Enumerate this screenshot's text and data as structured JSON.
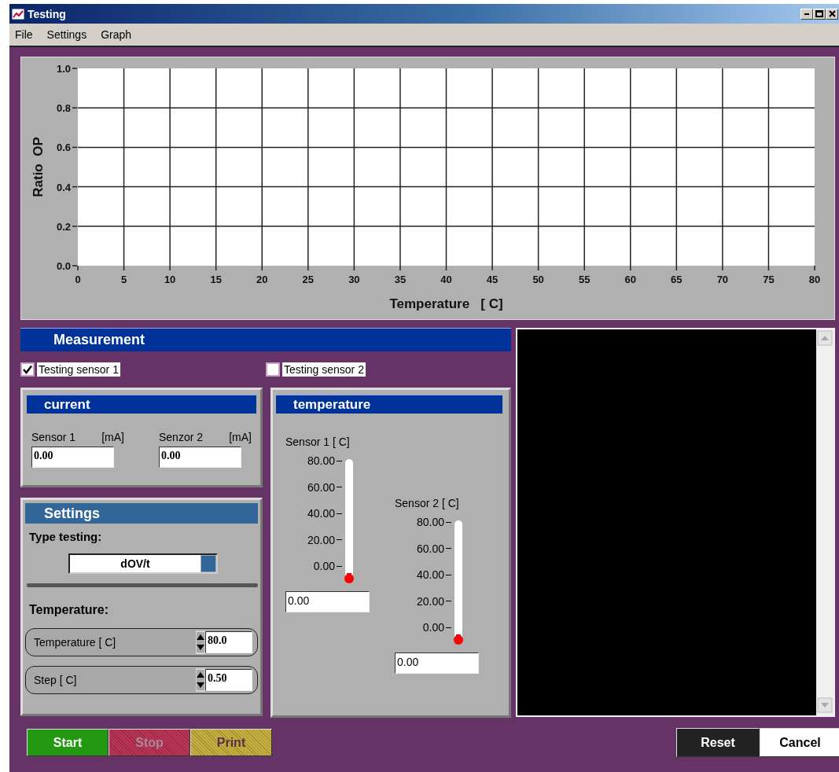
{
  "window": {
    "title": "Testing"
  },
  "menu": [
    {
      "label": "File"
    },
    {
      "label": "Settings"
    },
    {
      "label": "Graph"
    }
  ],
  "graph": {
    "chart_data": {
      "type": "line",
      "grid": true,
      "xlabel": "Temperature   [ C]",
      "ylabel": "Ratio  OP",
      "xlim": [
        0,
        80
      ],
      "ylim": [
        0,
        1
      ],
      "xticks": [
        0,
        5,
        10,
        15,
        20,
        25,
        30,
        35,
        40,
        45,
        50,
        55,
        60,
        65,
        70,
        75,
        80
      ],
      "yticks": [
        {
          "value": 0,
          "label": "0.0"
        },
        {
          "value": 0.2,
          "label": "0.2"
        },
        {
          "value": 0.4,
          "label": "0.4"
        },
        {
          "value": 0.6,
          "label": "0.6"
        },
        {
          "value": 0.8,
          "label": "0.8"
        },
        {
          "value": 1,
          "label": "1.0"
        }
      ]
    }
  },
  "measurement": {
    "title": "Measurement",
    "checkboxes": [
      {
        "label": "Testing sensor 1",
        "checked": true
      },
      {
        "label": "Testing sensor 2",
        "checked": false
      }
    ],
    "current": {
      "title": "current",
      "fields": [
        {
          "label": "Sensor 1",
          "unit": "[mA]",
          "value": "0.00"
        },
        {
          "label": "Senzor 2",
          "unit": "[mA]",
          "value": "0.00"
        }
      ]
    },
    "temperature": {
      "title": "temperature",
      "gauges": [
        {
          "label": "Sensor  1 [ C]",
          "ticks": [
            "80.00",
            "60.00",
            "40.00",
            "20.00",
            "0.00"
          ],
          "level": 0,
          "value": "0.00"
        },
        {
          "label": "Sensor  2 [ C]",
          "ticks": [
            "80.00",
            "60.00",
            "40.00",
            "20.00",
            "0.00"
          ],
          "level": 0,
          "value": "0.00"
        }
      ]
    }
  },
  "settings": {
    "title": "Settings",
    "type_label": "Type testing:",
    "type_value": "dOV/t",
    "temperature_label": "Temperature:",
    "spinners": [
      {
        "label": "Temperature  [ C]",
        "value": "80.0"
      },
      {
        "label": "Step  [ C]",
        "value": "0.50"
      }
    ]
  },
  "buttons": [
    {
      "label": "Start",
      "kind": "green",
      "disabled": false
    },
    {
      "label": "Stop",
      "kind": "red",
      "disabled": true
    },
    {
      "label": "Print",
      "kind": "yellow",
      "disabled": true
    }
  ],
  "dialog_buttons": [
    {
      "label": "Reset",
      "kind": "dark"
    },
    {
      "label": "Cancel",
      "kind": "light"
    }
  ]
}
